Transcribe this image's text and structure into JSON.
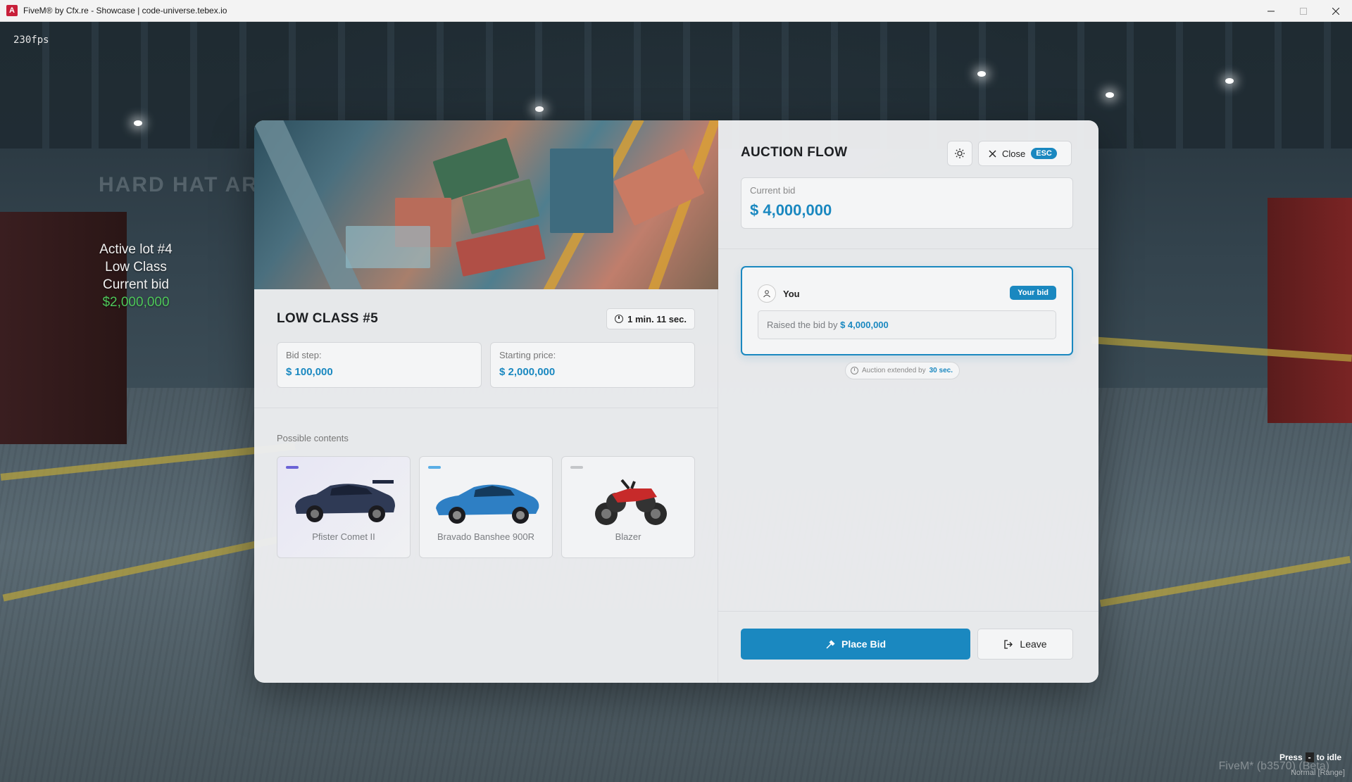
{
  "window": {
    "title": "FiveM® by Cfx.re - Showcase | code-universe.tebex.io",
    "app_icon": "fivem-icon",
    "controls": [
      "minimize",
      "maximize",
      "close"
    ]
  },
  "hud": {
    "fps": "230fps",
    "lot_info": {
      "line1": "Active lot #4",
      "line2": "Low Class",
      "line3": "Current bid",
      "amount": "$2,000,000"
    },
    "bottom_hint": {
      "press": "Press",
      "key": "-",
      "action": "to idle"
    },
    "watermark": "FiveM* (b3570) (Beta)",
    "watermark_sub": "Normal [Range]"
  },
  "lot": {
    "title": "LOW CLASS #5",
    "timer": "1 min. 11 sec.",
    "bid_step_label": "Bid step:",
    "bid_step_value": "$ 100,000",
    "starting_price_label": "Starting price:",
    "starting_price_value": "$ 2,000,000",
    "contents_label": "Possible contents",
    "items": [
      {
        "name": "Pfister Comet II",
        "rarity_color": "#6b63d6"
      },
      {
        "name": "Bravado Banshee 900R",
        "rarity_color": "#5aaee6"
      },
      {
        "name": "Blazer",
        "rarity_color": "#c4c6c9"
      }
    ]
  },
  "auction": {
    "title": "AUCTION FLOW",
    "close_label": "Close",
    "esc_label": "ESC",
    "current_bid_label": "Current bid",
    "current_bid_value": "$ 4,000,000",
    "entries": [
      {
        "user": "You",
        "badge": "Your bid",
        "message_prefix": "Raised the bid by",
        "message_amount": "$ 4,000,000"
      }
    ],
    "extended_prefix": "Auction extended by",
    "extended_value": "30 sec.",
    "place_bid_label": "Place Bid",
    "leave_label": "Leave"
  },
  "colors": {
    "accent": "#1a88c0",
    "money_green": "#4ec65a"
  }
}
